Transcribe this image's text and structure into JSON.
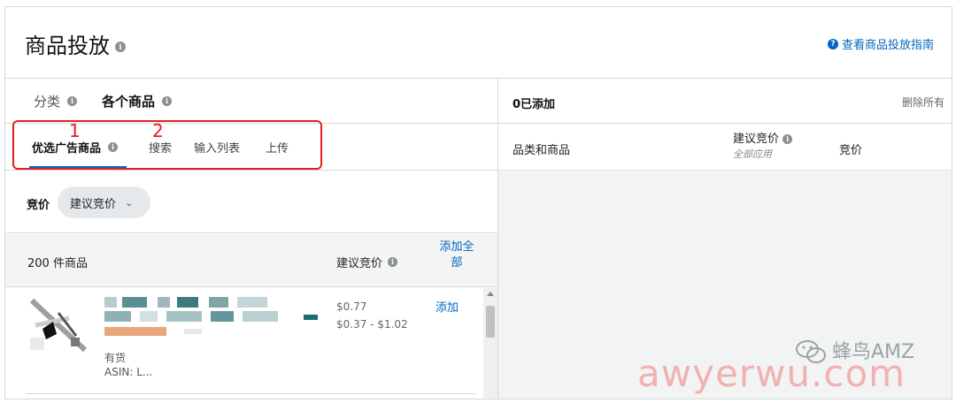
{
  "header": {
    "title": "商品投放",
    "guide_link": "查看商品投放指南"
  },
  "left": {
    "category_tabs": [
      {
        "label": "分类"
      },
      {
        "label": "各个商品"
      }
    ],
    "sub_tabs": [
      {
        "label": "优选广告商品"
      },
      {
        "label": "搜索"
      },
      {
        "label": "输入列表"
      },
      {
        "label": "上传"
      }
    ],
    "annotations": [
      "1",
      "2"
    ],
    "bid": {
      "label": "竞价",
      "selected": "建议竞价"
    },
    "list": {
      "count": "200 件商品",
      "suggested_bid_header": "建议竞价",
      "add_all": "添加全部"
    },
    "item": {
      "stock": "有货",
      "asin": "ASIN: L...",
      "price": "$0.77",
      "range": "$0.37 - $1.02",
      "add": "添加"
    }
  },
  "right": {
    "added": "0已添加",
    "remove_all": "删除所有",
    "columns": {
      "category": "品类和商品",
      "suggested": "建议竞价",
      "apply_all": "全部应用",
      "bid": "竞价"
    }
  },
  "watermark": {
    "name": "蜂鸟AMZ",
    "url": "awyerwu.com"
  },
  "colors": {
    "link": "#0066c0",
    "annotation": "#e02020",
    "border": "#d5d9d9"
  }
}
